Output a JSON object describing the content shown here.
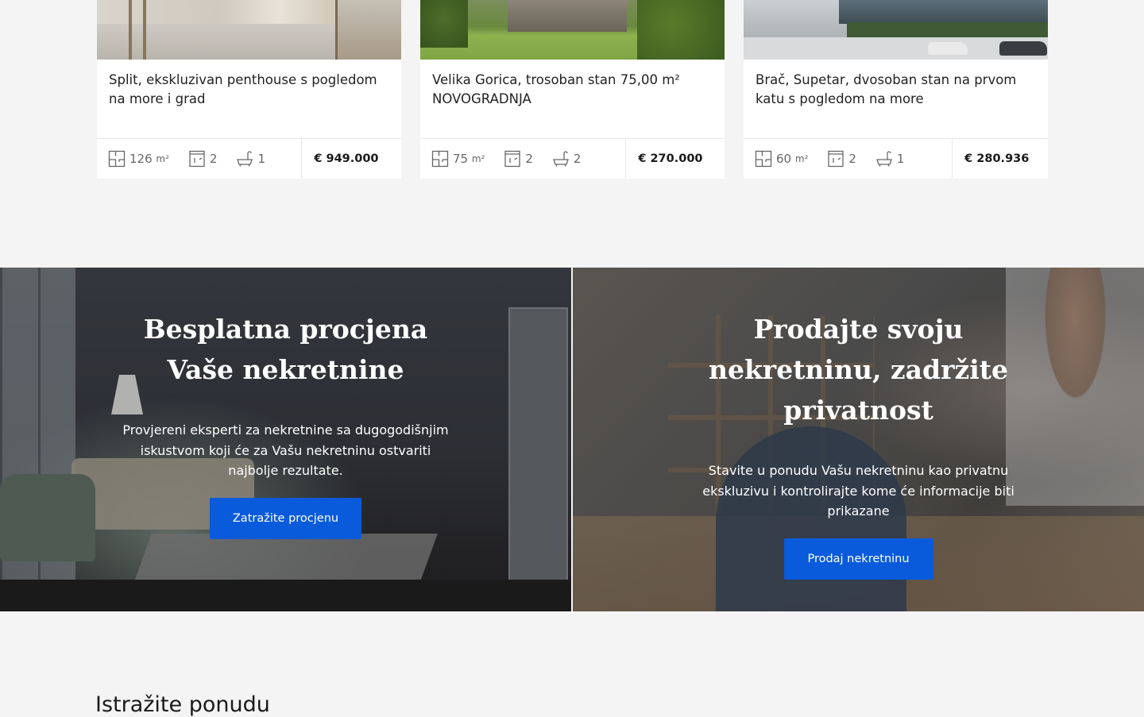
{
  "listings": [
    {
      "title": "Split, ekskluzivan penthouse s pogledom na more i grad",
      "area": "126",
      "area_unit": "m²",
      "rooms": "2",
      "bathrooms": "1",
      "price": "€ 949.000"
    },
    {
      "title": "Velika Gorica, trosoban stan 75,00 m² NOVOGRADNJA",
      "area": "75",
      "area_unit": "m²",
      "rooms": "2",
      "bathrooms": "2",
      "price": "€ 270.000"
    },
    {
      "title": "Brač, Supetar, dvosoban stan na prvom katu s pogledom na more",
      "area": "60",
      "area_unit": "m²",
      "rooms": "2",
      "bathrooms": "1",
      "price": "€ 280.936"
    }
  ],
  "promos": {
    "valuation": {
      "title": "Besplatna procjena Vaše nekretnine",
      "text": "Provjereni eksperti za nekretnine sa dugogodišnjim iskustvom koji će za Vašu nekretninu ostvariti najbolje rezultate.",
      "button": "Zatražite procjenu"
    },
    "sell": {
      "title": "Prodajte svoju nekretninu, zadržite privatnost",
      "text": "Stavite u ponudu Vašu nekretninu kao privatnu ekskluzivu i kontrolirajte kome će informacije biti prikazane",
      "button": "Prodaj nekretninu"
    }
  },
  "explore": {
    "heading": "Istražite ponudu"
  },
  "colors": {
    "primary_button": "#0a5bdc",
    "page_background": "#f4f4f4"
  },
  "icons": [
    "floor-plan-icon",
    "door-icon",
    "bathtub-icon"
  ]
}
